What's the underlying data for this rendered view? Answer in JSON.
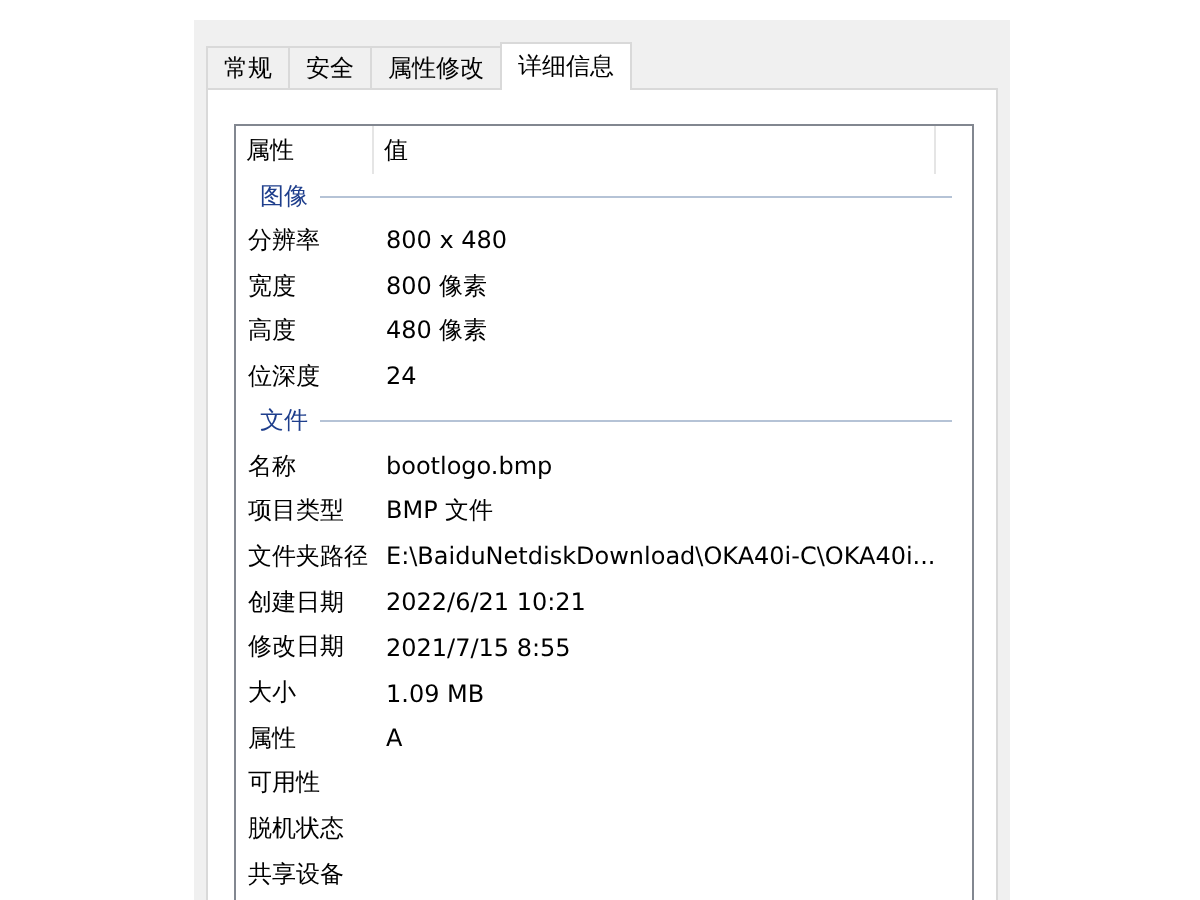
{
  "tabs": [
    {
      "label": "常规",
      "selected": false
    },
    {
      "label": "安全",
      "selected": false
    },
    {
      "label": "属性修改",
      "selected": false
    },
    {
      "label": "详细信息",
      "selected": true
    }
  ],
  "table": {
    "columns": [
      "属性",
      "值"
    ],
    "rows": [
      {
        "kind": "group",
        "name": "图像"
      },
      {
        "kind": "row",
        "name": "分辨率",
        "value": "800 x 480"
      },
      {
        "kind": "row",
        "name": "宽度",
        "value": "800 像素"
      },
      {
        "kind": "row",
        "name": "高度",
        "value": "480 像素"
      },
      {
        "kind": "row",
        "name": "位深度",
        "value": "24"
      },
      {
        "kind": "group",
        "name": "文件"
      },
      {
        "kind": "row",
        "name": "名称",
        "value": "bootlogo.bmp"
      },
      {
        "kind": "row",
        "name": "项目类型",
        "value": "BMP 文件"
      },
      {
        "kind": "row",
        "name": "文件夹路径",
        "value": "E:\\BaiduNetdiskDownload\\OKA40i-C\\OKA40i..."
      },
      {
        "kind": "row",
        "name": "创建日期",
        "value": "2022/6/21 10:21"
      },
      {
        "kind": "row",
        "name": "修改日期",
        "value": "2021/7/15 8:55"
      },
      {
        "kind": "row",
        "name": "大小",
        "value": "1.09 MB"
      },
      {
        "kind": "row",
        "name": "属性",
        "value": "A"
      },
      {
        "kind": "row",
        "name": "可用性"
      },
      {
        "kind": "row",
        "name": "脱机状态"
      },
      {
        "kind": "row",
        "name": "共享设备"
      }
    ]
  }
}
